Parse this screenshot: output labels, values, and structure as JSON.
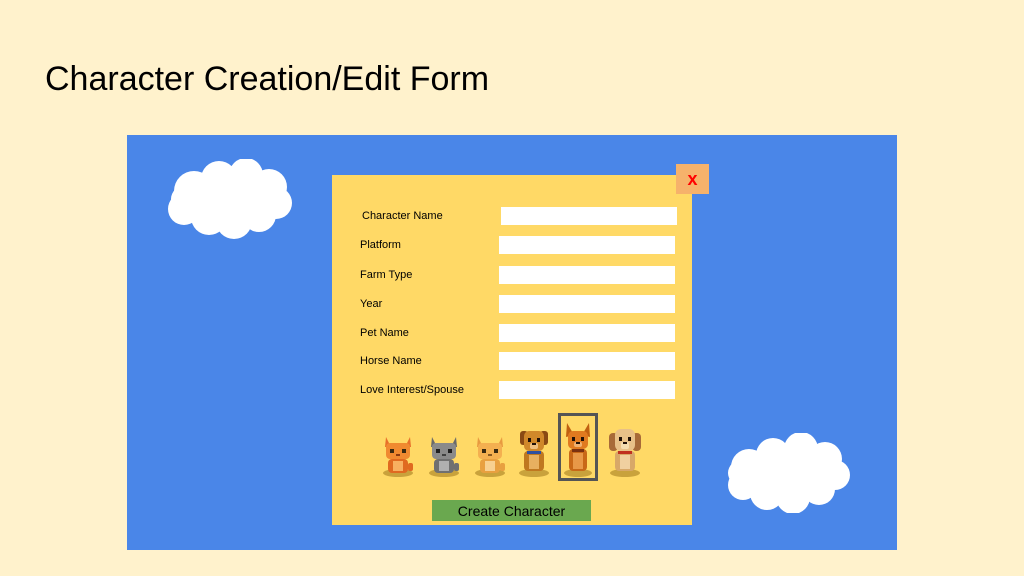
{
  "page": {
    "title": "Character Creation/Edit Form"
  },
  "dialog": {
    "close_label": "x",
    "fields": [
      {
        "label": "Character Name",
        "value": ""
      },
      {
        "label": "Platform",
        "value": ""
      },
      {
        "label": "Farm Type",
        "value": ""
      },
      {
        "label": "Year",
        "value": ""
      },
      {
        "label": "Pet Name",
        "value": ""
      },
      {
        "label": "Horse Name",
        "value": ""
      },
      {
        "label": "Love Interest/Spouse",
        "value": ""
      }
    ],
    "pets": [
      {
        "name": "orange-cat-icon"
      },
      {
        "name": "gray-cat-icon"
      },
      {
        "name": "yellow-cat-icon"
      },
      {
        "name": "brown-dog-icon"
      },
      {
        "name": "orange-dog-icon",
        "selected": true
      },
      {
        "name": "tan-dog-icon"
      }
    ],
    "submit_label": "Create Character"
  },
  "colors": {
    "background": "#fff2cc",
    "sky": "#4a86e8",
    "dialog": "#ffd966",
    "close_button": "#f6b26b",
    "close_text": "#ff0000",
    "submit_button": "#6aa84f"
  }
}
